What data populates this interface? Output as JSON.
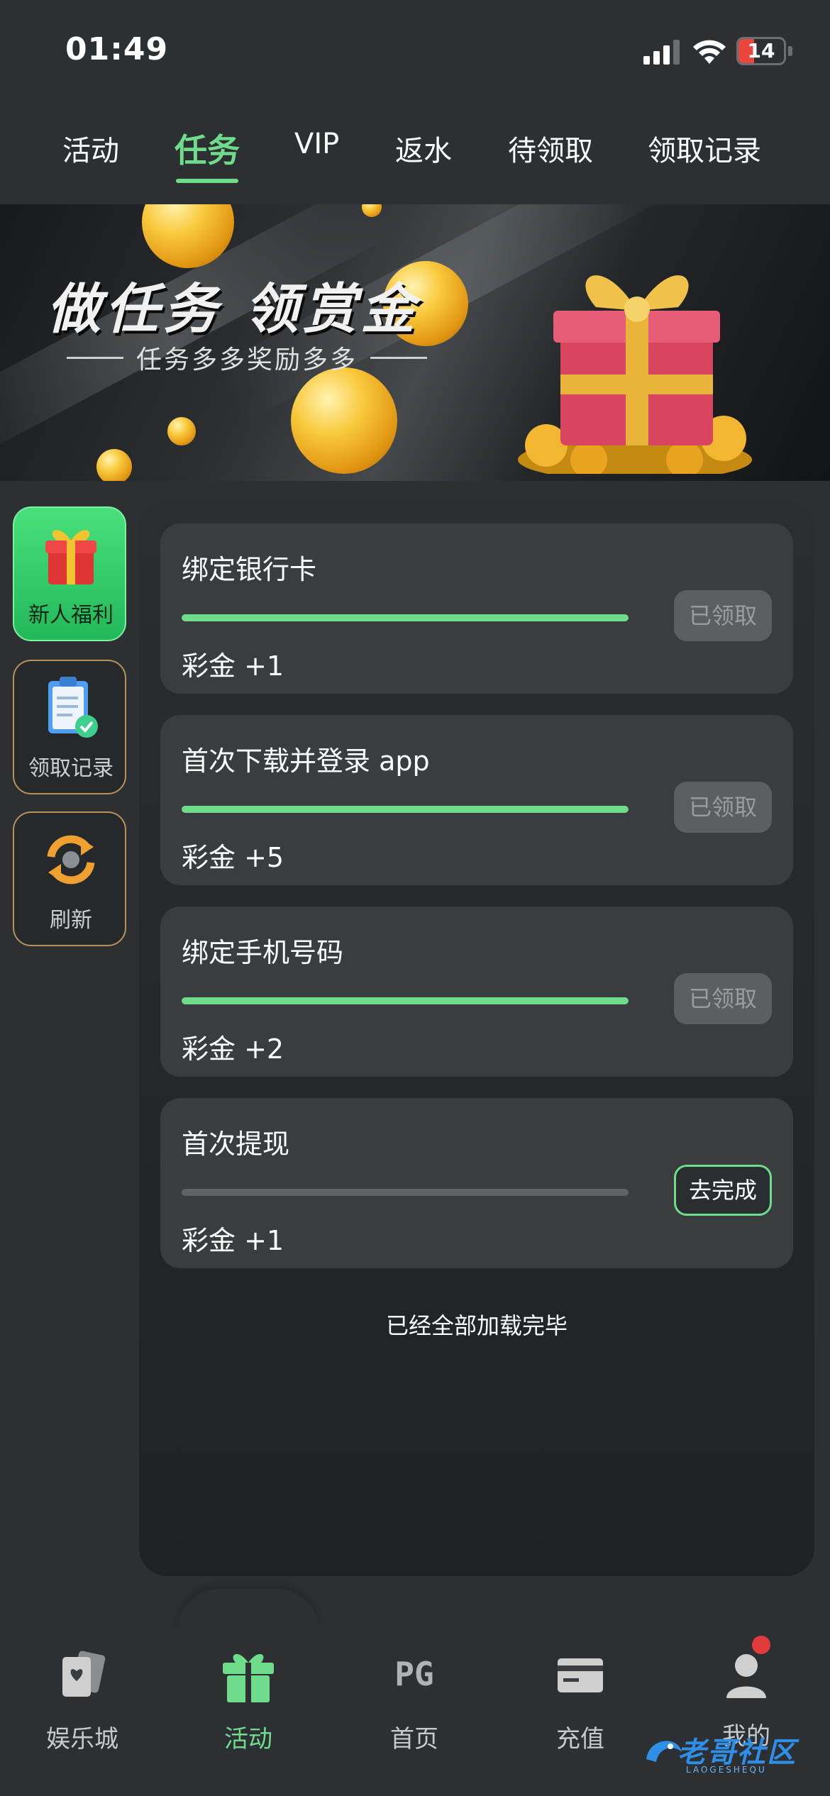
{
  "status_bar": {
    "time": "01:49",
    "battery": "14",
    "battery_level": 0.14
  },
  "tabs": [
    {
      "label": "活动",
      "active": false
    },
    {
      "label": "任务",
      "active": true
    },
    {
      "label": "VIP",
      "active": false
    },
    {
      "label": "返水",
      "active": false
    },
    {
      "label": "待领取",
      "active": false
    },
    {
      "label": "领取记录",
      "active": false
    }
  ],
  "banner": {
    "title": "做任务 领赏金",
    "subtitle": "任务多多奖励多多"
  },
  "side_menu": [
    {
      "label": "新人福利",
      "icon": "gift-icon",
      "active": true
    },
    {
      "label": "领取记录",
      "icon": "clipboard-icon",
      "active": false
    },
    {
      "label": "刷新",
      "icon": "refresh-icon",
      "active": false
    }
  ],
  "tasks": [
    {
      "title": "绑定银行卡",
      "reward": "彩金 +1",
      "progress": 1.0,
      "button": "已领取",
      "status": "claimed"
    },
    {
      "title": "首次下载并登录 app",
      "reward": "彩金 +5",
      "progress": 1.0,
      "button": "已领取",
      "status": "claimed"
    },
    {
      "title": "绑定手机号码",
      "reward": "彩金 +2",
      "progress": 1.0,
      "button": "已领取",
      "status": "claimed"
    },
    {
      "title": "首次提现",
      "reward": "彩金 +1",
      "progress": 0.0,
      "button": "去完成",
      "status": "todo"
    }
  ],
  "load_end_text": "已经全部加载完毕",
  "bottom_nav": [
    {
      "label": "娱乐城",
      "icon": "cards-icon",
      "active": false
    },
    {
      "label": "活动",
      "icon": "gift-icon",
      "active": true
    },
    {
      "label": "首页",
      "icon": "pg-logo-icon",
      "active": false
    },
    {
      "label": "充值",
      "icon": "card-icon",
      "active": false
    },
    {
      "label": "我的",
      "icon": "user-icon",
      "active": false,
      "badge": true
    }
  ],
  "watermark": {
    "text": "老哥社区",
    "sub": "LAOGESHEQU"
  },
  "colors": {
    "accent": "#6fdc8c",
    "background": "#2c3033",
    "card": "#393d40",
    "badge": "#e23b3b"
  }
}
